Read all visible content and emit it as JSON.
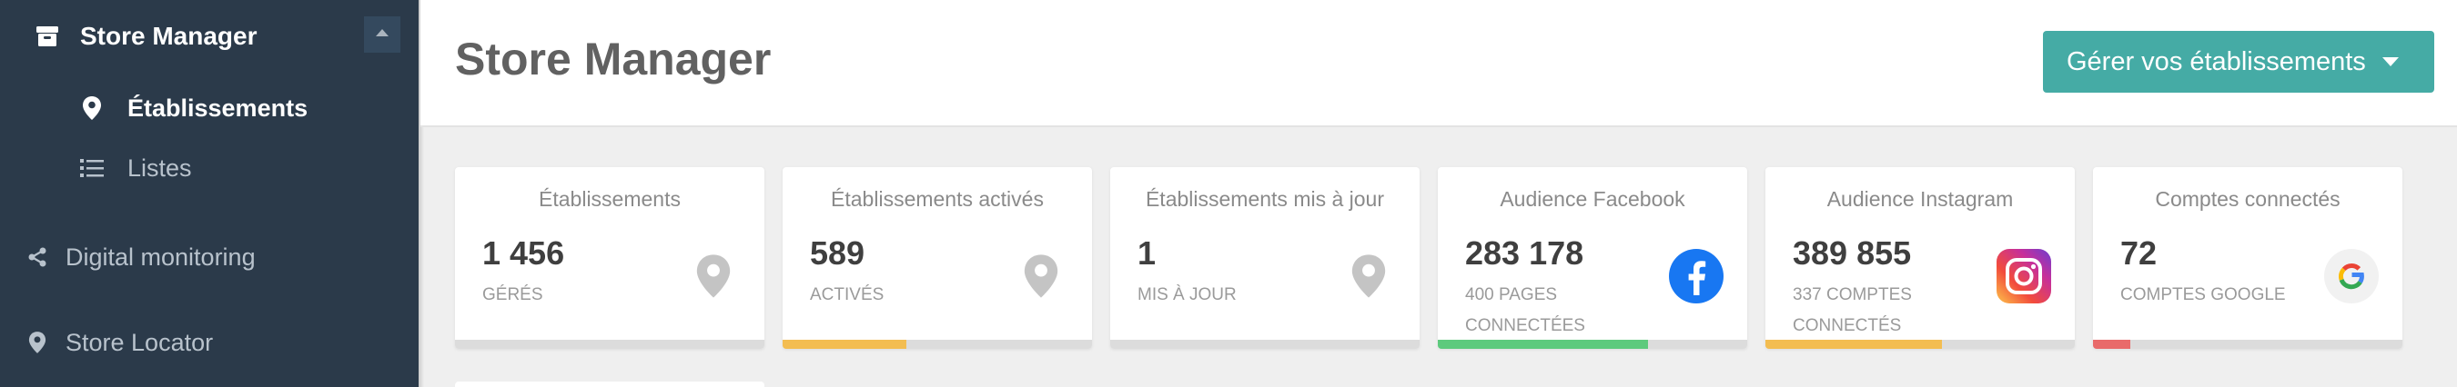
{
  "sidebar": {
    "store_manager": "Store Manager",
    "etablissements": "Établissements",
    "listes": "Listes",
    "digital_monitoring": "Digital monitoring",
    "store_locator": "Store Locator"
  },
  "header": {
    "title": "Store Manager",
    "manage_button": "Gérer vos établissements"
  },
  "cards": [
    {
      "title": "Établissements",
      "value": "1 456",
      "sub": "GÉRÉS",
      "icon": "map-pin-icon",
      "progress": 0,
      "bar_color": "#dcdcdc"
    },
    {
      "title": "Établissements activés",
      "value": "589",
      "sub": "ACTIVÉS",
      "icon": "map-pin-icon",
      "progress": 0.4,
      "bar_color": "#f3bd51"
    },
    {
      "title": "Établissements mis à jour",
      "value": "1",
      "sub": "MIS À JOUR",
      "icon": "map-pin-icon",
      "progress": 0,
      "bar_color": "#dcdcdc"
    },
    {
      "title": "Audience Facebook",
      "value": "283 178",
      "sub": "400 PAGES CONNECTÉES",
      "icon": "facebook-icon",
      "progress": 0.68,
      "bar_color": "#5dca7d"
    },
    {
      "title": "Audience Instagram",
      "value": "389 855",
      "sub": "337 COMPTES CONNECTÉS",
      "icon": "instagram-icon",
      "progress": 0.57,
      "bar_color": "#f3bd51"
    },
    {
      "title": "Comptes connectés",
      "value": "72",
      "sub": "COMPTES GOOGLE",
      "icon": "google-icon",
      "progress": 0.12,
      "bar_color": "#e96a6a"
    }
  ],
  "colors": {
    "sidebar_bg": "#2b3a4a",
    "accent": "#45aba5"
  }
}
